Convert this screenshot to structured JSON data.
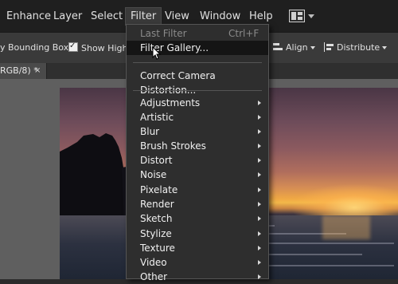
{
  "menubar": {
    "items": [
      "Enhance",
      "Layer",
      "Select",
      "Filter",
      "View",
      "Window",
      "Help"
    ]
  },
  "options": {
    "bounding_box": "y Bounding Box",
    "show_highlight": "Show Highl",
    "align": "Align",
    "distribute": "Distribute"
  },
  "document": {
    "tab_label": "RGB/8) *",
    "close_glyph": "×"
  },
  "filter_menu": {
    "last_filter": "Last Filter",
    "last_filter_shortcut": "Ctrl+F",
    "filter_gallery": "Filter Gallery...",
    "correct_camera": "Correct Camera Distortion...",
    "submenus": [
      "Adjustments",
      "Artistic",
      "Blur",
      "Brush Strokes",
      "Distort",
      "Noise",
      "Pixelate",
      "Render",
      "Sketch",
      "Stylize",
      "Texture",
      "Video",
      "Other"
    ]
  },
  "icons": {
    "layout": "layout-panels-icon",
    "close": "close-icon",
    "cursor": "mouse-pointer-icon"
  },
  "colors": {
    "menubar_bg": "#1f1f1f",
    "menu_bg": "#2e2e2e",
    "highlight_bg": "#151515"
  }
}
